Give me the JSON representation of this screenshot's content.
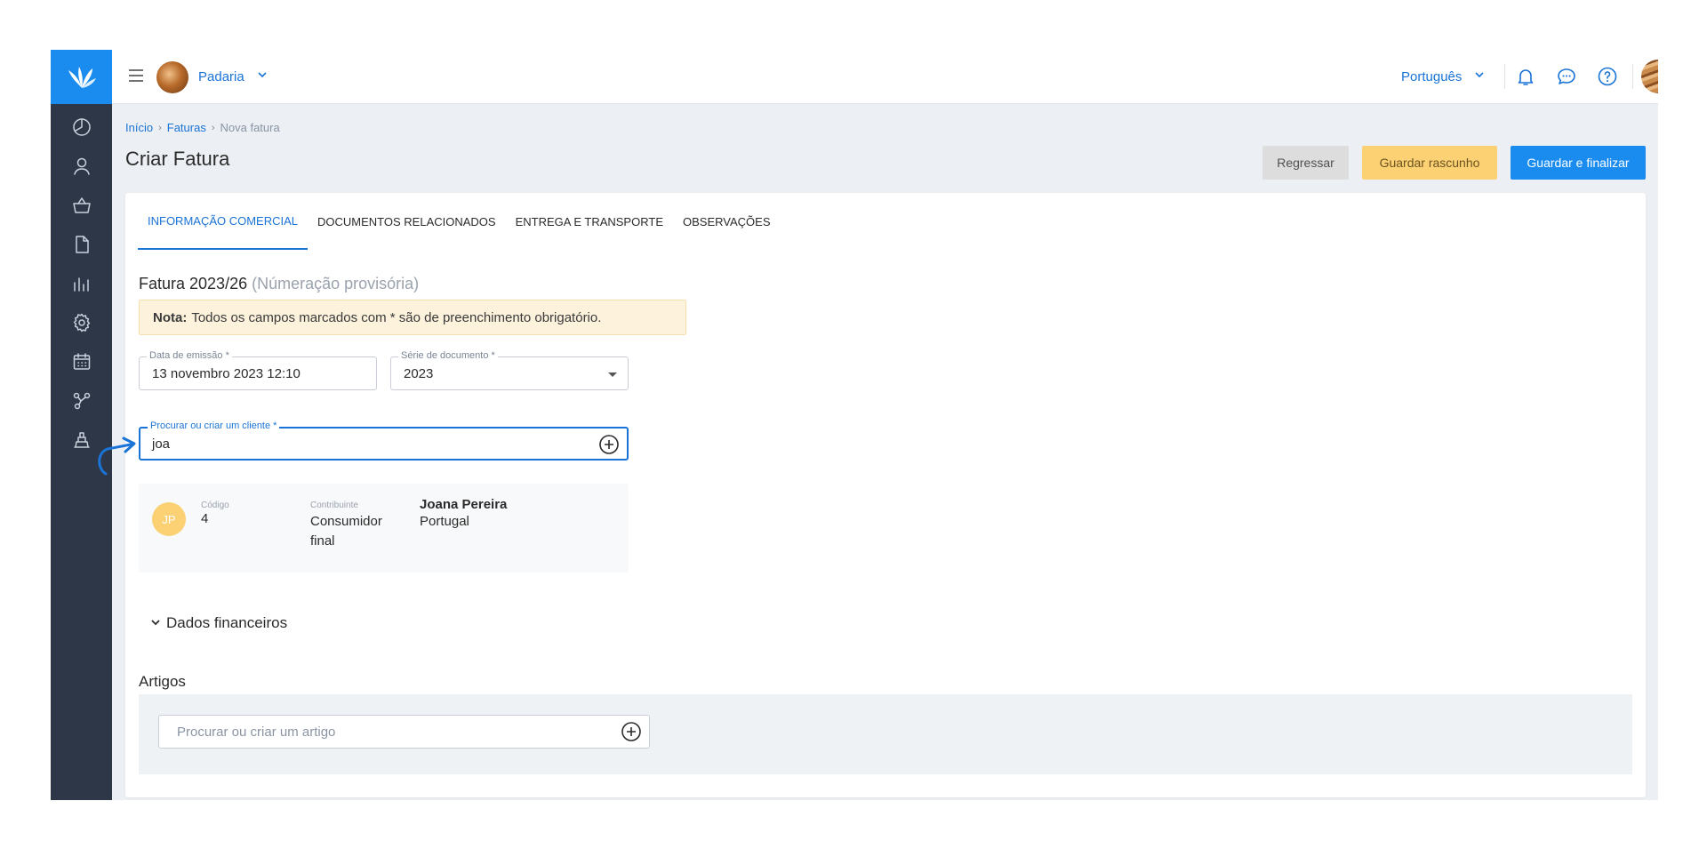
{
  "topbar": {
    "company_name": "Padaria",
    "language": "Português"
  },
  "breadcrumb": {
    "items": [
      "Início",
      "Faturas"
    ],
    "current": "Nova fatura"
  },
  "page": {
    "title": "Criar Fatura"
  },
  "actions": {
    "back_label": "Regressar",
    "draft_label": "Guardar rascunho",
    "finalize_label": "Guardar e finalizar"
  },
  "tabs": [
    {
      "label": "INFORMAÇÃO COMERCIAL",
      "active": true
    },
    {
      "label": "DOCUMENTOS RELACIONADOS",
      "active": false
    },
    {
      "label": "ENTREGA E TRANSPORTE",
      "active": false
    },
    {
      "label": "OBSERVAÇÕES",
      "active": false
    }
  ],
  "invoice": {
    "number": "Fatura 2023/26",
    "provisional": "(Númeração provisória)"
  },
  "note": {
    "prefix": "Nota:",
    "text": "Todos os campos marcados com * são de preenchimento obrigatório."
  },
  "fields": {
    "date_label": "Data de emissão *",
    "date_value": "13 novembro 2023 12:10",
    "series_label": "Série de documento *",
    "series_value": "2023",
    "client_label": "Procurar ou criar um cliente *",
    "client_value": "joa"
  },
  "client_result": {
    "initials": "JP",
    "code_label": "Código",
    "code_value": "4",
    "taxpayer_label": "Contribuinte",
    "taxpayer_value_1": "Consumidor",
    "taxpayer_value_2": "final",
    "name": "Joana Pereira",
    "country": "Portugal"
  },
  "sections": {
    "financial": "Dados financeiros",
    "articles": "Artigos",
    "article_placeholder": "Procurar ou criar um artigo"
  },
  "colors": {
    "primary": "#1a8cf0",
    "sidebar": "#2d3748",
    "draft": "#fcd173",
    "note_bg": "#fdf2dc"
  },
  "icons": {
    "sidebar": [
      "dashboard-icon",
      "user-icon",
      "basket-icon",
      "document-icon",
      "reports-icon",
      "settings-icon",
      "calendar-icon",
      "integrations-icon",
      "pos-icon"
    ]
  }
}
